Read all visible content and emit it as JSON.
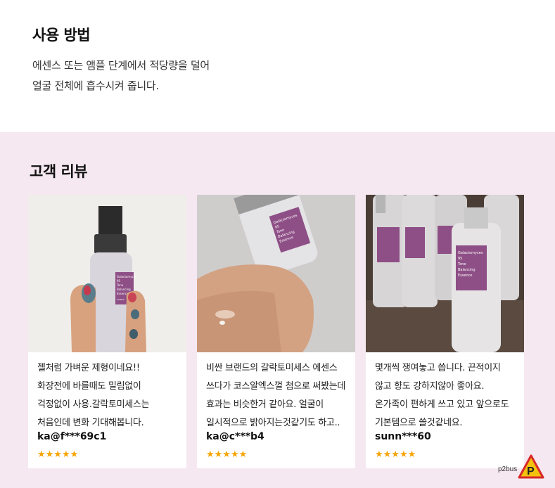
{
  "usage": {
    "title": "사용 방법",
    "lines": [
      "에센스 또는 앰플 단계에서 적당량을 덜어",
      "얼굴 전체에 흡수시켜 줍니다."
    ]
  },
  "reviews": {
    "title": "고객 리뷰",
    "items": [
      {
        "lines": [
          "젤처럼 가벼운 제형이네요!!",
          "화장전에 바를때도 밀림없이",
          "걱정없이 사용.갈락토미세스는",
          "처음인데 변화 기대해봅니다."
        ],
        "user": "ka@f***69c1",
        "stars": "★★★★★",
        "rating": 5,
        "label": [
          "Galactomyces",
          "95",
          "Tone",
          "Balancing",
          "Essence",
          "COSRX"
        ]
      },
      {
        "lines": [
          "비싼 브랜드의 갈락토미세스 에센스",
          "쓰다가 코스알엑스껄 첨으로 써봤는데",
          "효과는 비슷한거 같아요. 얼굴이",
          "일시적으로 밝아지는것같기도 하고.."
        ],
        "user": "ka@c***b4",
        "stars": "★★★★★",
        "rating": 5,
        "label": [
          "Galactomyces",
          "95",
          "Tone",
          "Balancing",
          "Essence"
        ]
      },
      {
        "lines": [
          "몇개씩 쟁여놓고 씁니다. 끈적이지",
          "않고 향도 강하지않아 좋아요.",
          "온가족이 편하게 쓰고 있고 앞으로도",
          "기본템으로 쓸것같네요."
        ],
        "user": "sunn***60",
        "stars": "★★★★★",
        "rating": 5,
        "label": [
          "Galactomyces",
          "95",
          "Tone",
          "Balancing",
          "Essence"
        ]
      }
    ]
  },
  "watermark": {
    "text": "p2bus",
    "badge": "P"
  },
  "colors": {
    "review_bg": "#f5e8f1",
    "star": "#f5a400",
    "label_purple": "#8e4f86"
  }
}
